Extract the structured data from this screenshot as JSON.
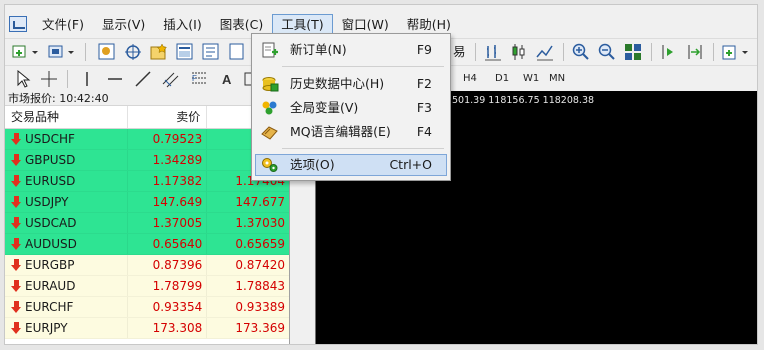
{
  "menubar": {
    "items": [
      {
        "label": "文件(F)"
      },
      {
        "label": "显示(V)"
      },
      {
        "label": "插入(I)"
      },
      {
        "label": "图表(C)"
      },
      {
        "label": "工具(T)"
      },
      {
        "label": "窗口(W)"
      },
      {
        "label": "帮助(H)"
      }
    ]
  },
  "toolbar": {
    "trade_text": "易",
    "timeframes": [
      "H4",
      "D1",
      "W1",
      "MN"
    ]
  },
  "tools_menu": {
    "items": [
      {
        "label": "新订单(N)",
        "shortcut": "F9",
        "icon": "new-order-icon"
      },
      {
        "label": "历史数据中心(H)",
        "shortcut": "F2",
        "icon": "history-center-icon"
      },
      {
        "label": "全局变量(V)",
        "shortcut": "F3",
        "icon": "global-variables-icon"
      },
      {
        "label": "MQ语言编辑器(E)",
        "shortcut": "F4",
        "icon": "metaeditor-icon"
      },
      {
        "label": "选项(O)",
        "shortcut": "Ctrl+O",
        "icon": "options-icon"
      }
    ]
  },
  "market_watch": {
    "title": "市场报价: 10:42:40",
    "columns": {
      "symbol": "交易品种",
      "bid": "卖价",
      "ask": ""
    },
    "rows": [
      {
        "symbol": "USDCHF",
        "bid": "0.79523",
        "ask": "0.",
        "hl": "green"
      },
      {
        "symbol": "GBPUSD",
        "bid": "1.34289",
        "ask": "1.",
        "hl": "green"
      },
      {
        "symbol": "EURUSD",
        "bid": "1.17382",
        "ask": "1.17404",
        "hl": "green"
      },
      {
        "symbol": "USDJPY",
        "bid": "147.649",
        "ask": "147.677",
        "hl": "green"
      },
      {
        "symbol": "USDCAD",
        "bid": "1.37005",
        "ask": "1.37030",
        "hl": "green"
      },
      {
        "symbol": "AUDUSD",
        "bid": "0.65640",
        "ask": "0.65659",
        "hl": "green"
      },
      {
        "symbol": "EURGBP",
        "bid": "0.87396",
        "ask": "0.87420",
        "hl": "pale"
      },
      {
        "symbol": "EURAUD",
        "bid": "1.78799",
        "ask": "1.78843",
        "hl": "pale"
      },
      {
        "symbol": "EURCHF",
        "bid": "0.93354",
        "ask": "0.93389",
        "hl": "pale"
      },
      {
        "symbol": "EURJPY",
        "bid": "173.308",
        "ask": "173.369",
        "hl": "pale"
      }
    ]
  },
  "chart": {
    "info": "501.39 118156.75 118208.38"
  },
  "colors": {
    "green_row": "#2ee493",
    "pale_row": "#fdfbe0",
    "price_red": "#d40000",
    "menu_highlight": "#cfe0f4"
  }
}
